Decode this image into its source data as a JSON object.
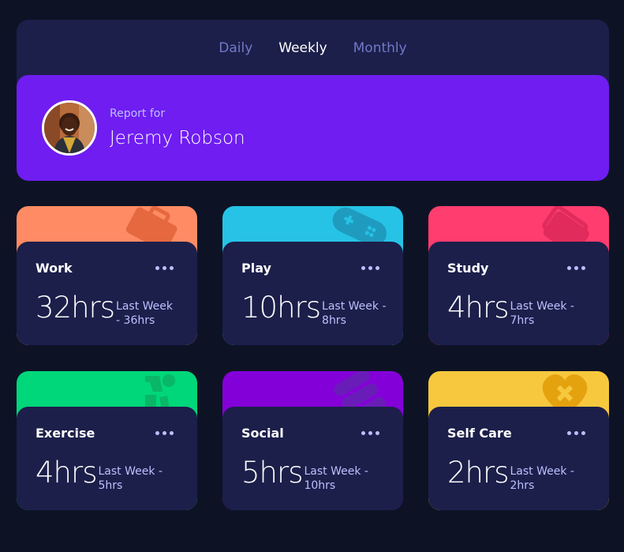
{
  "tabs": [
    {
      "label": "Daily",
      "active": false
    },
    {
      "label": "Weekly",
      "active": true
    },
    {
      "label": "Monthly",
      "active": false
    }
  ],
  "profile": {
    "report_label": "Report for",
    "name": "Jeremy Robson"
  },
  "activities": [
    {
      "title": "Work",
      "current": "32hrs",
      "previous": "Last Week - 36hrs",
      "color": "#ff8b64",
      "icon": "briefcase-icon"
    },
    {
      "title": "Play",
      "current": "10hrs",
      "previous": "Last Week - 8hrs",
      "color": "#55c2e6",
      "icon": "gamepad-icon"
    },
    {
      "title": "Study",
      "current": "4hrs",
      "previous": "Last Week - 7hrs",
      "color": "#ff5e7d",
      "icon": "book-icon"
    },
    {
      "title": "Exercise",
      "current": "4hrs",
      "previous": "Last Week - 5hrs",
      "color": "#4bcf82",
      "icon": "runner-icon"
    },
    {
      "title": "Social",
      "current": "5hrs",
      "previous": "Last Week - 10hrs",
      "color": "#7335d2",
      "icon": "chat-icon"
    },
    {
      "title": "Self Care",
      "current": "2hrs",
      "previous": "Last Week - 2hrs",
      "color": "#f1c75b",
      "icon": "heart-icon"
    }
  ]
}
